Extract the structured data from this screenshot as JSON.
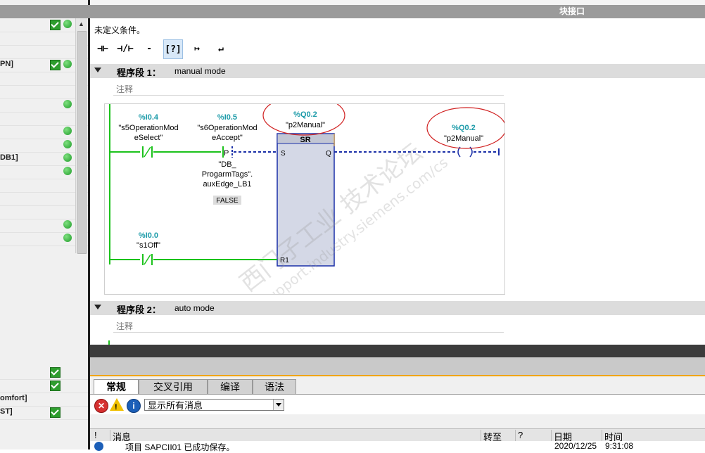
{
  "left_panel": {
    "rows": [
      {
        "text": "",
        "check": true,
        "dot": true
      },
      {
        "text": "",
        "check": false,
        "dot": false
      },
      {
        "text": "",
        "check": false,
        "dot": false
      },
      {
        "text": "PN]",
        "check": true,
        "dot": true
      },
      {
        "text": "",
        "check": false,
        "dot": false
      },
      {
        "text": "",
        "check": false,
        "dot": false
      },
      {
        "text": "",
        "check": false,
        "dot": true
      },
      {
        "text": "",
        "check": false,
        "dot": false
      },
      {
        "text": "",
        "check": false,
        "dot": true
      },
      {
        "text": "",
        "check": false,
        "dot": true
      },
      {
        "text": "DB1]",
        "check": false,
        "dot": true
      },
      {
        "text": "",
        "check": false,
        "dot": true
      },
      {
        "text": "",
        "check": false,
        "dot": false
      },
      {
        "text": "",
        "check": false,
        "dot": false
      },
      {
        "text": "",
        "check": false,
        "dot": false
      },
      {
        "text": "",
        "check": false,
        "dot": true
      },
      {
        "text": "",
        "check": false,
        "dot": true
      }
    ],
    "bottom_rows": [
      {
        "text": "",
        "check": true
      },
      {
        "text": "",
        "check": true
      },
      {
        "text": "omfort]",
        "check": false
      },
      {
        "text": "ST]",
        "check": true
      }
    ]
  },
  "header": {
    "label": "块接口"
  },
  "editor": {
    "undefined_condition": "未定义条件。",
    "toolbar_icons": [
      "normally-open-contact-icon",
      "normally-closed-contact-icon",
      "coil-icon",
      "empty-box-icon",
      "open-branch-icon",
      "close-branch-icon"
    ],
    "network1": {
      "segment_label": "程序段 1：",
      "title": "manual mode",
      "comment": "注释",
      "contact1_addr": "%I0.4",
      "contact1_name_line1": "\"s5OperationMod",
      "contact1_name_line2": "eSelect\"",
      "contact2_addr": "%I0.5",
      "contact2_name_line1": "\"s6OperationMod",
      "contact2_name_line2": "eAccept\"",
      "edge_tag_line1": "\"DB_",
      "edge_tag_line2": "ProgarmTags\".",
      "edge_tag_line3": "auxEdge_LB1",
      "edge_tag_value": "FALSE",
      "edge_label": "P",
      "sr_addr": "%Q0.2",
      "sr_name": "\"p2Manual\"",
      "sr_title": "SR",
      "sr_pin_s": "S",
      "sr_pin_q": "Q",
      "sr_pin_r1": "R1",
      "coil_addr": "%Q0.2",
      "coil_name": "\"p2Manual\"",
      "contact3_addr": "%I0.0",
      "contact3_name": "\"s1Off\""
    },
    "network2": {
      "segment_label": "程序段 2：",
      "title": "auto mode",
      "comment": "注释"
    },
    "watermark_cn": "西门子工业  技术论坛",
    "watermark_url": "support.industry.siemens.com/cs"
  },
  "bottom_panel": {
    "tabs": [
      "常规",
      "交叉引用",
      "编译",
      "语法"
    ],
    "filter_value": "显示所有消息",
    "columns": [
      "!",
      "消息",
      "转至",
      "?",
      "日期",
      "时间"
    ],
    "message": {
      "text": "项目 SAPCII01 已成功保存。",
      "date": "2020/12/25",
      "time": "9:31:08"
    }
  },
  "colors": {
    "contact_green": "#1cc21c",
    "address_teal": "#1a9aa8",
    "annotation_red": "#d02020",
    "dashed_blue": "#1a2fa8",
    "sr_fill": "#d4d8e6"
  }
}
